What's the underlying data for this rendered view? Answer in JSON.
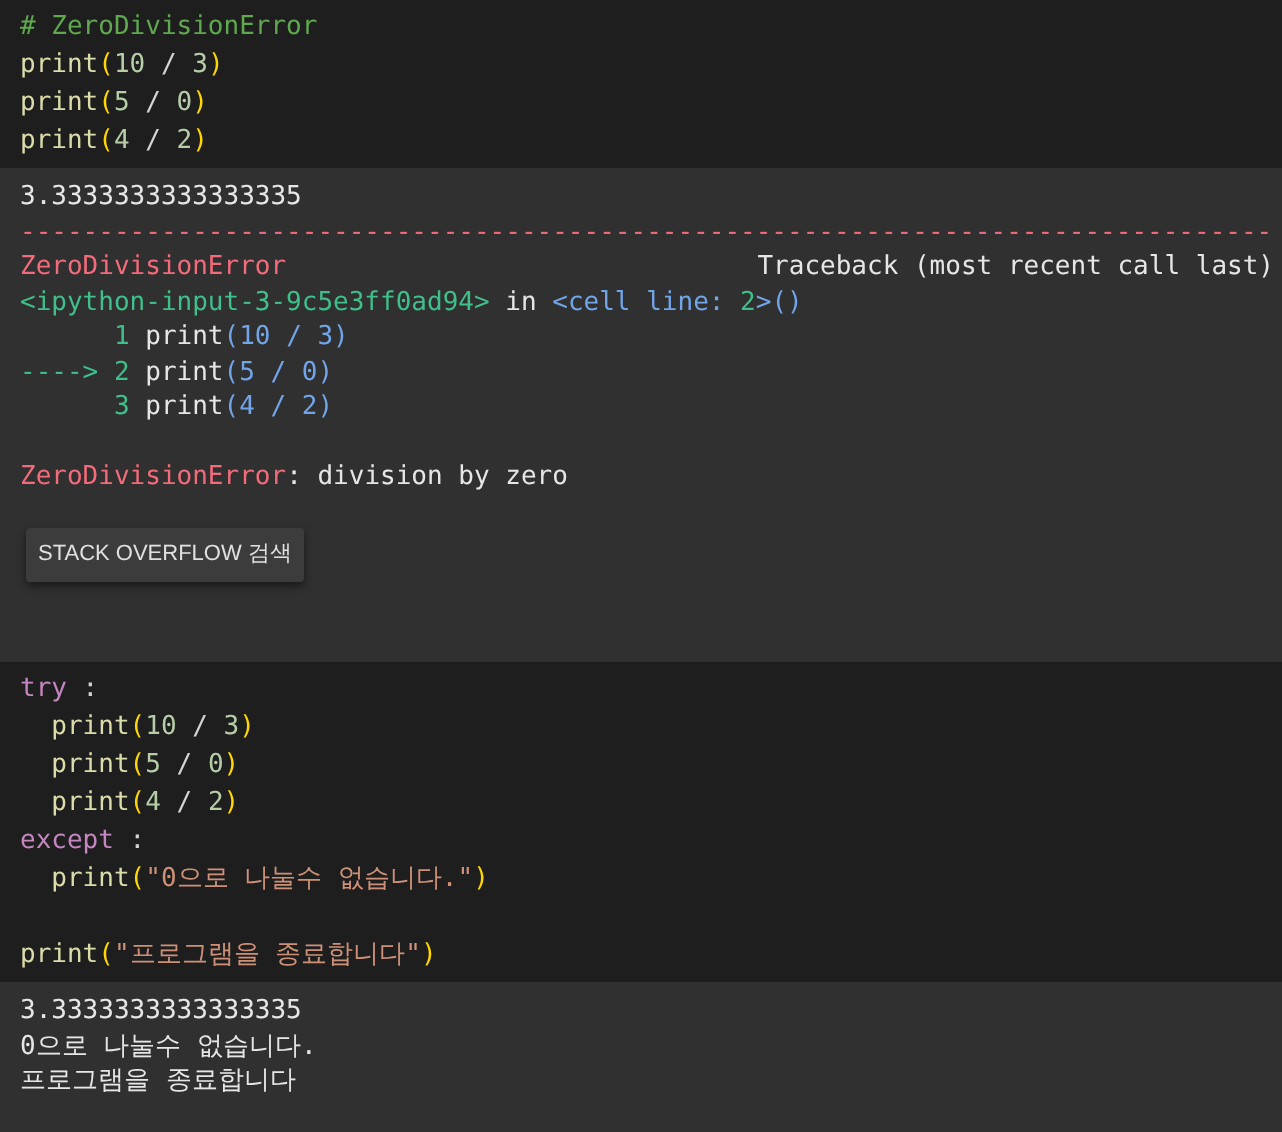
{
  "cells": [
    {
      "kind": "code",
      "lines": [
        {
          "tokens": [
            {
              "kind": "comment",
              "text": "# ZeroDivisionError"
            }
          ]
        },
        {
          "tokens": [
            {
              "kind": "fn",
              "text": "print"
            },
            {
              "kind": "paren",
              "text": "("
            },
            {
              "kind": "num",
              "text": "10"
            },
            {
              "kind": "op",
              "text": " / "
            },
            {
              "kind": "num",
              "text": "3"
            },
            {
              "kind": "paren",
              "text": ")"
            }
          ]
        },
        {
          "tokens": [
            {
              "kind": "fn",
              "text": "print"
            },
            {
              "kind": "paren",
              "text": "("
            },
            {
              "kind": "num",
              "text": "5"
            },
            {
              "kind": "op",
              "text": " / "
            },
            {
              "kind": "num",
              "text": "0"
            },
            {
              "kind": "paren",
              "text": ")"
            }
          ]
        },
        {
          "tokens": [
            {
              "kind": "fn",
              "text": "print"
            },
            {
              "kind": "paren",
              "text": "("
            },
            {
              "kind": "num",
              "text": "4"
            },
            {
              "kind": "op",
              "text": " / "
            },
            {
              "kind": "num",
              "text": "2"
            },
            {
              "kind": "paren",
              "text": ")"
            }
          ]
        }
      ]
    },
    {
      "kind": "output",
      "lines": [
        {
          "kind": "line",
          "tokens": [
            {
              "kind": "text",
              "text": "3.3333333333333335"
            }
          ]
        },
        {
          "kind": "line",
          "tokens": [
            {
              "kind": "error",
              "text": "--------------------------------------------------------------------------------"
            }
          ]
        },
        {
          "kind": "split",
          "left": [
            {
              "kind": "error",
              "text": "ZeroDivisionError"
            }
          ],
          "right": [
            {
              "kind": "text",
              "text": "Traceback (most recent call last)"
            }
          ]
        },
        {
          "kind": "line",
          "tokens": [
            {
              "kind": "green",
              "text": "<ipython-input-3-9c5e3ff0ad94>"
            },
            {
              "kind": "text",
              "text": " in "
            },
            {
              "kind": "blue",
              "text": "<cell line: "
            },
            {
              "kind": "green",
              "text": "2"
            },
            {
              "kind": "blue",
              "text": ">()"
            }
          ]
        },
        {
          "kind": "line",
          "tokens": [
            {
              "kind": "green",
              "text": "      1 "
            },
            {
              "kind": "text",
              "text": "print"
            },
            {
              "kind": "blue",
              "text": "(10 / 3)"
            }
          ]
        },
        {
          "kind": "line",
          "tokens": [
            {
              "kind": "green",
              "text": "----> 2 "
            },
            {
              "kind": "text",
              "text": "print"
            },
            {
              "kind": "blue",
              "text": "(5 / 0)"
            }
          ]
        },
        {
          "kind": "line",
          "tokens": [
            {
              "kind": "green",
              "text": "      3 "
            },
            {
              "kind": "text",
              "text": "print"
            },
            {
              "kind": "blue",
              "text": "(4 / 2)"
            }
          ]
        },
        {
          "kind": "blank"
        },
        {
          "kind": "line",
          "tokens": [
            {
              "kind": "error",
              "text": "ZeroDivisionError"
            },
            {
              "kind": "text",
              "text": ": division by zero"
            }
          ]
        }
      ],
      "button": "STACK OVERFLOW 검색"
    },
    {
      "kind": "code",
      "lines": [
        {
          "tokens": [
            {
              "kind": "keyword",
              "text": "try"
            },
            {
              "kind": "op",
              "text": " :"
            }
          ]
        },
        {
          "tokens": [
            {
              "kind": "fn",
              "text": "  print"
            },
            {
              "kind": "paren",
              "text": "("
            },
            {
              "kind": "num",
              "text": "10"
            },
            {
              "kind": "op",
              "text": " / "
            },
            {
              "kind": "num",
              "text": "3"
            },
            {
              "kind": "paren",
              "text": ")"
            }
          ]
        },
        {
          "tokens": [
            {
              "kind": "fn",
              "text": "  print"
            },
            {
              "kind": "paren",
              "text": "("
            },
            {
              "kind": "num",
              "text": "5"
            },
            {
              "kind": "op",
              "text": " / "
            },
            {
              "kind": "num",
              "text": "0"
            },
            {
              "kind": "paren",
              "text": ")"
            }
          ]
        },
        {
          "tokens": [
            {
              "kind": "fn",
              "text": "  print"
            },
            {
              "kind": "paren",
              "text": "("
            },
            {
              "kind": "num",
              "text": "4"
            },
            {
              "kind": "op",
              "text": " / "
            },
            {
              "kind": "num",
              "text": "2"
            },
            {
              "kind": "paren",
              "text": ")"
            }
          ]
        },
        {
          "tokens": [
            {
              "kind": "keyword",
              "text": "except"
            },
            {
              "kind": "op",
              "text": " :"
            }
          ]
        },
        {
          "tokens": [
            {
              "kind": "fn",
              "text": "  print"
            },
            {
              "kind": "paren",
              "text": "("
            },
            {
              "kind": "string",
              "text": "\"0으로 나눌수 없습니다.\""
            },
            {
              "kind": "paren",
              "text": ")"
            }
          ]
        },
        {
          "kind": "blank"
        },
        {
          "tokens": [
            {
              "kind": "fn",
              "text": "print"
            },
            {
              "kind": "paren",
              "text": "("
            },
            {
              "kind": "string",
              "text": "\"프로그램을 종료합니다\""
            },
            {
              "kind": "paren",
              "text": ")"
            }
          ]
        }
      ]
    },
    {
      "kind": "output",
      "lines": [
        {
          "kind": "line",
          "tokens": [
            {
              "kind": "text",
              "text": "3.3333333333333335"
            }
          ]
        },
        {
          "kind": "line",
          "tokens": [
            {
              "kind": "text",
              "text": "0으로 나눌수 없습니다."
            }
          ]
        },
        {
          "kind": "line",
          "tokens": [
            {
              "kind": "text",
              "text": "프로그램을 종료합니다"
            }
          ]
        }
      ]
    }
  ]
}
